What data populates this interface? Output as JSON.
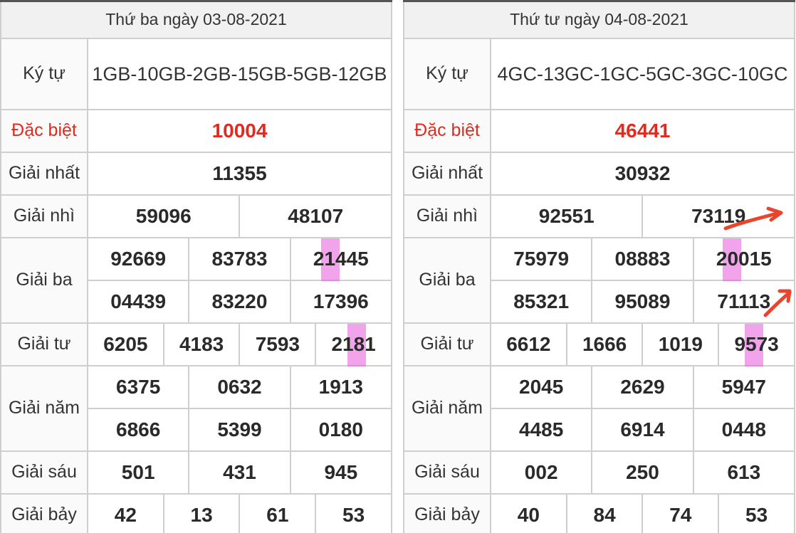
{
  "colors": {
    "special": "#e02b20",
    "highlight": "#e65adc",
    "arrow": "#e8452c"
  },
  "left": {
    "header": "Thứ ba ngày 03-08-2021",
    "labels": {
      "kytu": "Ký tự",
      "db": "Đặc biệt",
      "g1": "Giải nhất",
      "g2": "Giải nhì",
      "g3": "Giải ba",
      "g4": "Giải tư",
      "g5": "Giải năm",
      "g6": "Giải sáu",
      "g7": "Giải bảy"
    },
    "kytu": "1GB-10GB-2GB-15GB-5GB-12GB",
    "db": "10004",
    "g1": "11355",
    "g2": [
      "59096",
      "48107"
    ],
    "g3": [
      "92669",
      "83783",
      "21445",
      "04439",
      "83220",
      "17396"
    ],
    "g4": [
      "6205",
      "4183",
      "7593",
      "2181"
    ],
    "g5": [
      "6375",
      "0632",
      "1913",
      "6866",
      "5399",
      "0180"
    ],
    "g6": [
      "501",
      "431",
      "945"
    ],
    "g7": [
      "42",
      "13",
      "61",
      "53"
    ]
  },
  "right": {
    "header": "Thứ tư ngày 04-08-2021",
    "labels": {
      "kytu": "Ký tự",
      "db": "Đặc biệt",
      "g1": "Giải nhất",
      "g2": "Giải nhì",
      "g3": "Giải ba",
      "g4": "Giải tư",
      "g5": "Giải năm",
      "g6": "Giải sáu",
      "g7": "Giải bảy"
    },
    "kytu": "4GC-13GC-1GC-5GC-3GC-10GC",
    "db": "46441",
    "g1": "30932",
    "g2": [
      "92551",
      "73119"
    ],
    "g3": [
      "75979",
      "08883",
      "20015",
      "85321",
      "95089",
      "71113"
    ],
    "g4": [
      "6612",
      "1666",
      "1019",
      "9573"
    ],
    "g5": [
      "2045",
      "2629",
      "5947",
      "4485",
      "6914",
      "0448"
    ],
    "g6": [
      "002",
      "250",
      "613"
    ],
    "g7": [
      "40",
      "84",
      "74",
      "53"
    ]
  }
}
